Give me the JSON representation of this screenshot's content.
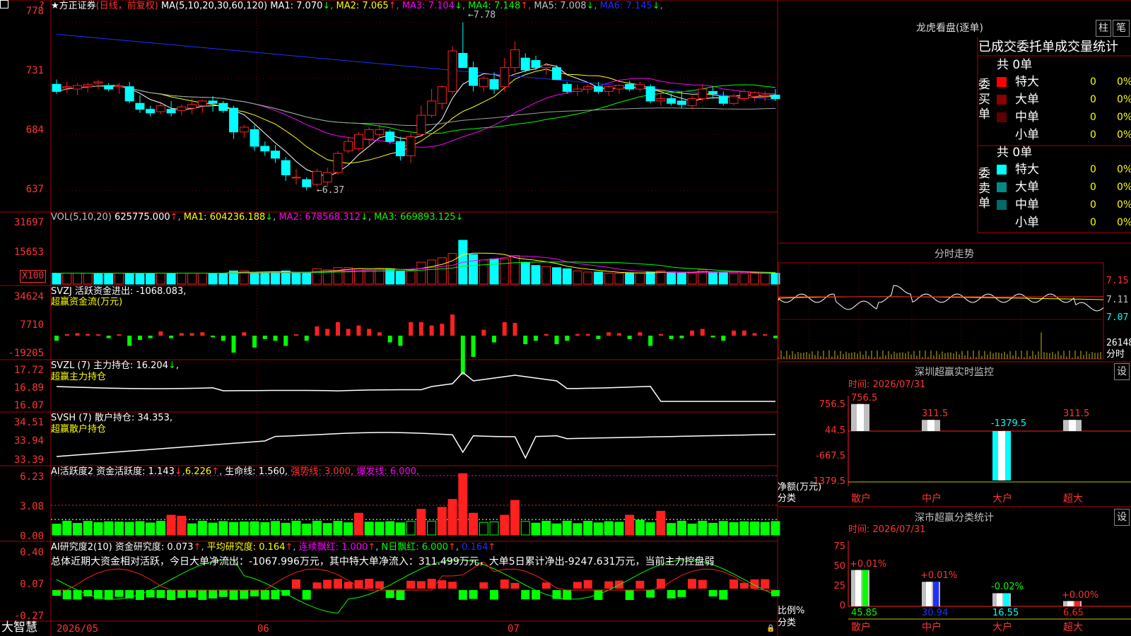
{
  "header": {
    "stock_name": "★方正证券",
    "period": "(日线，前复权)",
    "ma_params": "MA(5,10,20,30,60,120)",
    "ma_values": [
      {
        "label": "MA1:",
        "value": "7.070",
        "arrow": "↓",
        "color": "#ffffff"
      },
      {
        "label": "MA2:",
        "value": "7.065",
        "arrow": "↑",
        "color": "#ffff00"
      },
      {
        "label": "MA3:",
        "value": "7.104",
        "arrow": "↓",
        "color": "#ff00ff"
      },
      {
        "label": "MA4:",
        "value": "7.148",
        "arrow": "↑",
        "color": "#00ff00"
      },
      {
        "label": "MA5:",
        "value": "7.008",
        "arrow": "↓",
        "color": "#c0c0c0"
      },
      {
        "label": "MA6:",
        "value": "7.145",
        "arrow": "↓",
        "color": "#2030ff"
      }
    ],
    "corner_mark": "?"
  },
  "price_axis": [
    "778",
    "731",
    "684",
    "637"
  ],
  "price_annotations": {
    "high": "7.78",
    "low": "6.37"
  },
  "vol_panel": {
    "title": "VOL(5,10,20)",
    "value": "625775.000",
    "ma1": "MA1: 604236.188",
    "ma2": "MA2: 678568.312",
    "ma3": "MA3: 669893.125",
    "axis": [
      "31697",
      "15653"
    ],
    "unit": "X100"
  },
  "svzj_panel": {
    "title": "SVZJ  活跃资金进出: -1068.083",
    "subtitle": "超赢资金流(万元)",
    "axis": [
      "34624",
      "7710",
      "-19205"
    ]
  },
  "svzl_panel": {
    "title": "SVZL  (7) 主力持仓: 16.204",
    "subtitle": "超赢主力持仓",
    "axis": [
      "17.72",
      "16.89",
      "16.07"
    ]
  },
  "svsh_panel": {
    "title": "SVSH  (7) 散户持仓: 34.353",
    "subtitle": "超赢散户持仓",
    "axis": [
      "34.51",
      "33.94",
      "33.39"
    ]
  },
  "ai_act_panel": {
    "title": "AI活跃度2 资金活跃度: 1.143",
    "v2": "6.226",
    "life": "生命线: 1.560,",
    "strong": "强势线: 3.000,",
    "burst": "爆发线: 6.000,",
    "axis": [
      "6.23",
      "3.08",
      "0.00"
    ]
  },
  "ai_res_panel": {
    "title": "AI研究度2(10) 资金研究度: 0.073",
    "avg": "平均研究度: 0.164",
    "lianxu": "连续飘红: 1.000",
    "nday": "N日飘红: 6.000",
    "last": "0.164",
    "summary": "总体近期大资金相对活跃，今日大单净流出：-1067.996万元，其中特大单净流入：311.499万元，大单5日累计净出-9247.631万元，当前主力控盘弱",
    "axis": [
      "0.40",
      "0.07",
      "-0.27"
    ]
  },
  "date_axis": [
    "2026/05",
    "06",
    "07"
  ],
  "brand": "大智慧",
  "right_panel": {
    "dragon_title": "龙虎看盘(逐单)",
    "btn_zhu": "柱",
    "btn_bi": "笔",
    "tabs": "已成交委托单成交量统计",
    "buy": {
      "side_label": "委买单",
      "total": "共 0单",
      "rows": [
        {
          "name": "特大",
          "count": "0",
          "pct": "0%",
          "color": "#ff0000"
        },
        {
          "name": "大单",
          "count": "0",
          "pct": "0%",
          "color": "#8b0000"
        },
        {
          "name": "中单",
          "count": "0",
          "pct": "0%",
          "color": "#600000"
        },
        {
          "name": "小单",
          "count": "0",
          "pct": "0%",
          "color": ""
        }
      ]
    },
    "sell": {
      "side_label": "委卖单",
      "total": "共 0单",
      "rows": [
        {
          "name": "特大",
          "count": "0",
          "pct": "0%",
          "color": "#00ffff"
        },
        {
          "name": "大单",
          "count": "0",
          "pct": "0%",
          "color": "#008b8b"
        },
        {
          "name": "中单",
          "count": "0",
          "pct": "0%",
          "color": "#006b6b"
        },
        {
          "name": "小单",
          "count": "0",
          "pct": "0%",
          "color": ""
        }
      ]
    },
    "intraday_title": "分时走势",
    "intraday_axis": [
      "7.15",
      "7.11",
      "7.07"
    ],
    "intraday_vol": "26148",
    "intraday_label": "分时",
    "monitor": {
      "title": "深圳超赢实时监控",
      "btn": "设",
      "time": "时间: 2026/07/31",
      "axis": [
        "756.5",
        "44.5",
        "-667.5",
        "-1379.5"
      ],
      "ylabel": "净额(万元)",
      "xlabel": "分类",
      "categories": [
        "散户",
        "中户",
        "大户",
        "超大"
      ],
      "values": [
        "756.5",
        "311.5",
        "-1379.5",
        "311.5"
      ]
    },
    "classify": {
      "title": "深市超赢分类统计",
      "btn": "设",
      "time": "时间: 2026/07/31",
      "axis": [
        "75",
        "50",
        "25",
        "0"
      ],
      "ylabel": "比例%",
      "xlabel": "分类",
      "categories": [
        "散户",
        "中户",
        "大户",
        "超大"
      ],
      "changes": [
        "+0.01%",
        "+0.01%",
        "-0.02%",
        "+0.00%"
      ],
      "values": [
        "45.85",
        "30.94",
        "16.55",
        "6.65"
      ]
    }
  },
  "colors": {
    "up": "#ff2020",
    "down": "#00ffff",
    "border": "#b00000",
    "accent_yellow": "#ffff00"
  },
  "chart_data": [
    {
      "type": "candlestick",
      "title": "方正证券 日线",
      "ylim": [
        6.2,
        7.92
      ],
      "ohlc": [
        [
          7.26,
          7.3,
          7.18,
          7.2
        ],
        [
          7.23,
          7.28,
          7.19,
          7.24
        ],
        [
          7.22,
          7.27,
          7.17,
          7.25
        ],
        [
          7.24,
          7.27,
          7.19,
          7.26
        ],
        [
          7.27,
          7.3,
          7.22,
          7.28
        ],
        [
          7.25,
          7.27,
          7.2,
          7.22
        ],
        [
          7.24,
          7.27,
          7.18,
          7.25
        ],
        [
          7.24,
          7.28,
          7.1,
          7.12
        ],
        [
          7.1,
          7.17,
          7.02,
          7.05
        ],
        [
          7.05,
          7.08,
          6.99,
          7.02
        ],
        [
          7.03,
          7.1,
          7.01,
          7.08
        ],
        [
          7.05,
          7.12,
          6.99,
          7.02
        ],
        [
          7.04,
          7.09,
          7.0,
          7.07
        ],
        [
          7.06,
          7.14,
          7.01,
          7.09
        ],
        [
          7.08,
          7.13,
          7.02,
          7.12
        ],
        [
          7.12,
          7.16,
          7.03,
          7.1
        ],
        [
          7.1,
          7.12,
          7.02,
          7.04
        ],
        [
          7.06,
          7.08,
          6.8,
          6.86
        ],
        [
          6.86,
          6.92,
          6.81,
          6.9
        ],
        [
          6.88,
          6.92,
          6.7,
          6.74
        ],
        [
          6.74,
          6.78,
          6.66,
          6.7
        ],
        [
          6.7,
          6.75,
          6.6,
          6.64
        ],
        [
          6.62,
          6.65,
          6.45,
          6.5
        ],
        [
          6.48,
          6.55,
          6.42,
          6.48
        ],
        [
          6.46,
          6.48,
          6.37,
          6.4
        ],
        [
          6.42,
          6.55,
          6.4,
          6.53
        ],
        [
          6.44,
          6.56,
          6.4,
          6.52
        ],
        [
          6.52,
          6.7,
          6.5,
          6.68
        ],
        [
          6.7,
          6.82,
          6.68,
          6.78
        ],
        [
          6.72,
          6.86,
          6.7,
          6.84
        ],
        [
          6.8,
          6.9,
          6.75,
          6.88
        ],
        [
          6.84,
          6.92,
          6.8,
          6.88
        ],
        [
          6.86,
          6.88,
          6.76,
          6.78
        ],
        [
          6.78,
          6.82,
          6.62,
          6.66
        ],
        [
          6.66,
          6.85,
          6.6,
          6.82
        ],
        [
          6.84,
          7.08,
          6.82,
          7.0
        ],
        [
          7.0,
          7.22,
          6.98,
          7.12
        ],
        [
          7.1,
          7.25,
          7.05,
          7.24
        ],
        [
          7.2,
          7.58,
          7.18,
          7.54
        ],
        [
          7.52,
          7.78,
          7.48,
          7.4
        ],
        [
          7.4,
          7.45,
          7.2,
          7.25
        ],
        [
          7.24,
          7.33,
          7.2,
          7.31
        ],
        [
          7.3,
          7.36,
          7.18,
          7.22
        ],
        [
          7.24,
          7.48,
          7.2,
          7.4
        ],
        [
          7.4,
          7.62,
          7.36,
          7.55
        ],
        [
          7.48,
          7.52,
          7.36,
          7.38
        ],
        [
          7.46,
          7.5,
          7.38,
          7.4
        ],
        [
          7.4,
          7.44,
          7.34,
          7.42
        ],
        [
          7.4,
          7.42,
          7.3,
          7.3
        ],
        [
          7.26,
          7.28,
          7.18,
          7.2
        ],
        [
          7.2,
          7.26,
          7.16,
          7.22
        ],
        [
          7.22,
          7.26,
          7.18,
          7.24
        ],
        [
          7.24,
          7.28,
          7.18,
          7.2
        ],
        [
          7.2,
          7.25,
          7.16,
          7.24
        ],
        [
          7.22,
          7.26,
          7.18,
          7.25
        ],
        [
          7.26,
          7.29,
          7.2,
          7.22
        ],
        [
          7.22,
          7.28,
          7.2,
          7.26
        ],
        [
          7.24,
          7.26,
          7.1,
          7.12
        ],
        [
          7.12,
          7.18,
          7.08,
          7.14
        ],
        [
          7.14,
          7.18,
          7.08,
          7.1
        ],
        [
          7.12,
          7.2,
          7.06,
          7.09
        ],
        [
          7.08,
          7.16,
          7.05,
          7.14
        ],
        [
          7.14,
          7.26,
          7.12,
          7.22
        ],
        [
          7.2,
          7.24,
          7.14,
          7.18
        ],
        [
          7.16,
          7.2,
          7.08,
          7.1
        ],
        [
          7.1,
          7.18,
          7.08,
          7.16
        ],
        [
          7.14,
          7.22,
          7.12,
          7.2
        ],
        [
          7.16,
          7.2,
          7.12,
          7.19
        ],
        [
          7.16,
          7.2,
          7.12,
          7.17
        ],
        [
          7.17,
          7.22,
          7.12,
          7.14
        ]
      ]
    },
    {
      "type": "bar",
      "title": "VOL(5,10,20)",
      "unit": "x100",
      "values": [
        10,
        10,
        10,
        10,
        10,
        10,
        10,
        10,
        10,
        10,
        10,
        10,
        10,
        10,
        10,
        10,
        10,
        12,
        12,
        10,
        11,
        11,
        12,
        10,
        10,
        14,
        13,
        15,
        15,
        14,
        13,
        14,
        14,
        12,
        12,
        20,
        22,
        24,
        28,
        40,
        27,
        22,
        23,
        23,
        26,
        20,
        17,
        16,
        15,
        14,
        12,
        11,
        11,
        10,
        10,
        10,
        10,
        11,
        12,
        11,
        10,
        10,
        13,
        11,
        11,
        10,
        10,
        10,
        10,
        10
      ],
      "up": [
        0,
        1,
        1,
        1,
        0,
        0,
        1,
        0,
        0,
        0,
        1,
        0,
        1,
        1,
        1,
        0,
        0,
        0,
        1,
        0,
        0,
        0,
        0,
        0,
        0,
        1,
        1,
        1,
        1,
        1,
        1,
        1,
        0,
        0,
        1,
        1,
        1,
        1,
        1,
        0,
        0,
        1,
        0,
        1,
        1,
        0,
        0,
        1,
        0,
        0,
        1,
        1,
        0,
        1,
        1,
        0,
        1,
        0,
        1,
        0,
        0,
        1,
        1,
        0,
        0,
        1,
        1,
        1,
        1,
        0
      ],
      "ylim": [
        0,
        32000
      ]
    }
  ]
}
